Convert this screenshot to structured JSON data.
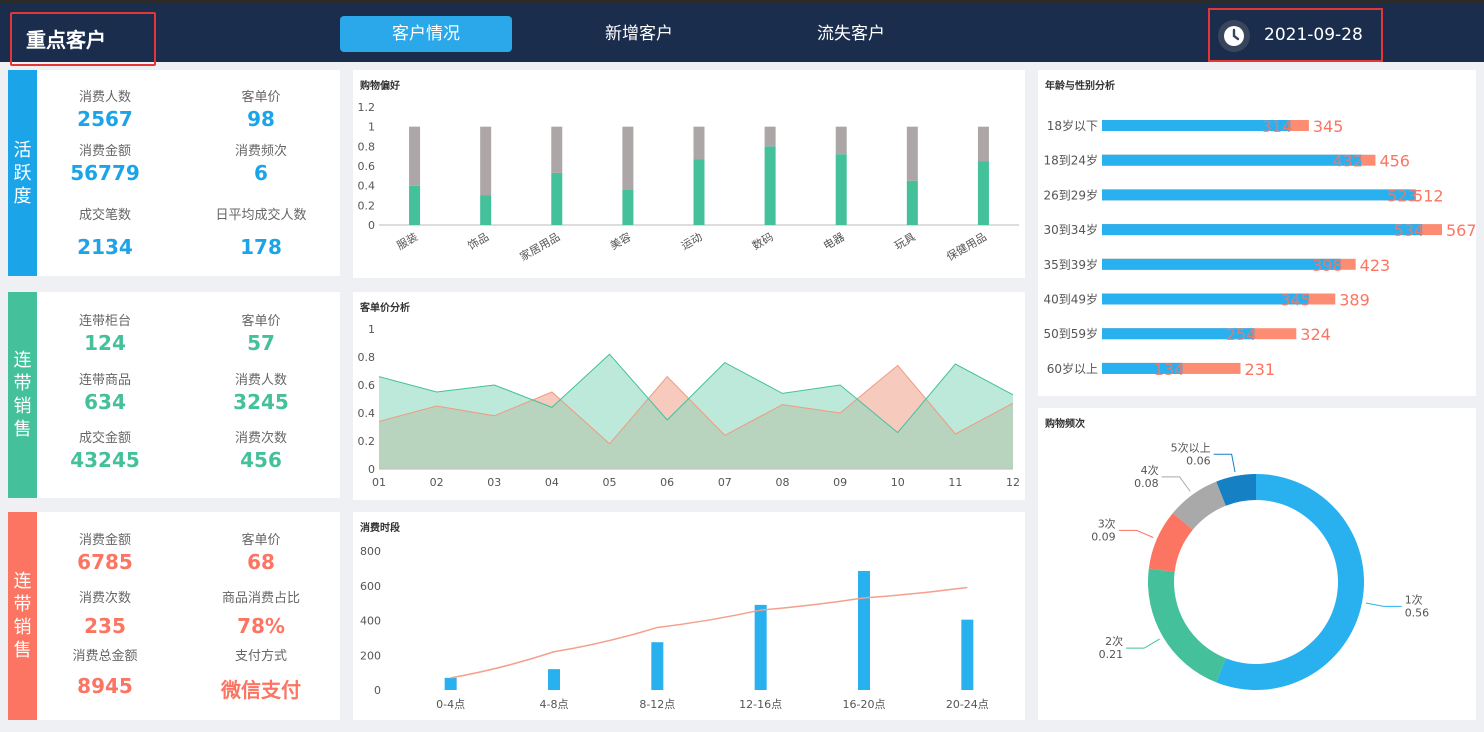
{
  "header": {
    "title": "重点客户",
    "tabs": [
      {
        "label": "客户情况"
      },
      {
        "label": "新增客户"
      },
      {
        "label": "流失客户"
      }
    ],
    "date": "2021-09-28"
  },
  "colors": {
    "blue": "#1ca4e8",
    "green": "#44c09a",
    "red": "#fc7563",
    "navy": "#1b2d4d"
  },
  "kpi_groups": [
    {
      "label": "活跃度",
      "items": [
        {
          "label": "消费人数",
          "value": "2567"
        },
        {
          "label": "客单价",
          "value": "98"
        },
        {
          "label": "消费金额",
          "value": "56779"
        },
        {
          "label": "消费频次",
          "value": "6"
        },
        {
          "label": "成交笔数",
          "value": "2134"
        },
        {
          "label": "日平均成交人数",
          "value": "178"
        }
      ]
    },
    {
      "label": "连带销售",
      "items": [
        {
          "label": "连带柜台",
          "value": "124"
        },
        {
          "label": "客单价",
          "value": "57"
        },
        {
          "label": "连带商品",
          "value": "634"
        },
        {
          "label": "消费人数",
          "value": "3245"
        },
        {
          "label": "成交金额",
          "value": "43245"
        },
        {
          "label": "消费次数",
          "value": "456"
        }
      ]
    },
    {
      "label": "连带销售",
      "items": [
        {
          "label": "消费金额",
          "value": "6785"
        },
        {
          "label": "客单价",
          "value": "68"
        },
        {
          "label": "消费次数",
          "value": "235"
        },
        {
          "label": "商品消费占比",
          "value": "78%"
        },
        {
          "label": "消费总金额",
          "value": "8945"
        },
        {
          "label": "支付方式",
          "value": "微信支付"
        }
      ]
    }
  ],
  "chart_data": [
    {
      "type": "bar",
      "title": "购物偏好",
      "stacked": true,
      "categories": [
        "服装",
        "饰品",
        "家居用品",
        "美容",
        "运动",
        "数码",
        "电器",
        "玩具",
        "保健用品"
      ],
      "series": [
        {
          "values": [
            0.4,
            0.3,
            0.53,
            0.36,
            0.67,
            0.8,
            0.72,
            0.45,
            0.65
          ]
        },
        {
          "values": [
            0.6,
            0.7,
            0.47,
            0.64,
            0.33,
            0.2,
            0.28,
            0.55,
            0.35
          ]
        }
      ],
      "ylim": [
        0,
        1.2
      ],
      "yticks": [
        "0",
        "0.2",
        "0.4",
        "0.6",
        "0.8",
        "1",
        "1.2"
      ]
    },
    {
      "type": "area",
      "title": "客单价分析",
      "categories": [
        "01",
        "02",
        "03",
        "04",
        "05",
        "06",
        "07",
        "08",
        "09",
        "10",
        "11",
        "12"
      ],
      "series": [
        {
          "values": [
            0.66,
            0.55,
            0.6,
            0.44,
            0.82,
            0.35,
            0.76,
            0.54,
            0.6,
            0.26,
            0.75,
            0.53
          ]
        },
        {
          "values": [
            0.34,
            0.45,
            0.38,
            0.55,
            0.18,
            0.66,
            0.24,
            0.46,
            0.4,
            0.74,
            0.25,
            0.47
          ]
        }
      ],
      "ylim": [
        0,
        1
      ],
      "yticks": [
        "0",
        "0.2",
        "0.4",
        "0.6",
        "0.8",
        "1"
      ]
    },
    {
      "type": "bar",
      "title": "消费时段",
      "categories": [
        "0-4点",
        "4-8点",
        "8-12点",
        "12-16点",
        "16-20点",
        "20-24点"
      ],
      "series": [
        {
          "values": [
            70,
            120,
            275,
            490,
            685,
            405
          ]
        }
      ],
      "trend_line": {
        "values": [
          70,
          220,
          360,
          460,
          530,
          590
        ]
      },
      "ylim": [
        0,
        800
      ],
      "yticks": [
        "0",
        "200",
        "400",
        "600",
        "800"
      ]
    },
    {
      "type": "bar",
      "title": "年龄与性别分析",
      "orientation": "horizontal",
      "categories": [
        "18岁以下",
        "18到24岁",
        "26到29岁",
        "30到34岁",
        "35到39岁",
        "40到49岁",
        "50到59岁",
        "60岁以上"
      ],
      "series": [
        {
          "values": [
            314,
            432,
            523,
            534,
            398,
            345,
            254,
            134
          ],
          "labels": [
            "314",
            "432",
            "523",
            "534",
            "398",
            "345",
            "254",
            "134"
          ]
        },
        {
          "values": [
            345,
            456,
            512,
            567,
            423,
            389,
            324,
            231
          ],
          "labels": [
            "345",
            "456",
            "512",
            "567",
            "423",
            "389",
            "324",
            "231"
          ]
        }
      ]
    },
    {
      "type": "pie",
      "title": "购物频次",
      "donut": true,
      "slices": [
        {
          "label": "1次",
          "value": 0.56,
          "value_text": "0.56",
          "color": "#29b0ee"
        },
        {
          "label": "2次",
          "value": 0.21,
          "value_text": "0.21",
          "color": "#44c09a"
        },
        {
          "label": "3次",
          "value": 0.09,
          "value_text": "0.09",
          "color": "#fc7563"
        },
        {
          "label": "4次",
          "value": 0.08,
          "value_text": "0.08",
          "color": "#a9a9a9"
        },
        {
          "label": "5次以上",
          "value": 0.06,
          "value_text": "0.06",
          "color": "#1580c4"
        }
      ]
    }
  ]
}
